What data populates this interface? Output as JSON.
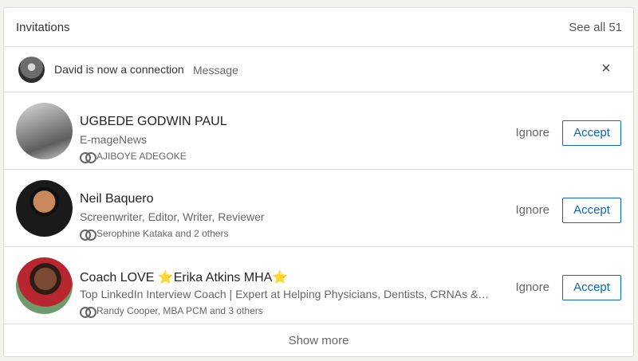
{
  "header": {
    "title": "Invitations",
    "see_all": "See all 51"
  },
  "notice": {
    "text": "David is now a connection",
    "message_label": "Message",
    "close_glyph": "×"
  },
  "invitations": [
    {
      "name": "UGBEDE GODWIN PAUL",
      "headline": "E-mageNews",
      "mutual": "AJIBOYE ADEGOKE",
      "ignore_label": "Ignore",
      "accept_label": "Accept"
    },
    {
      "name": "Neil Baquero",
      "headline": "Screenwriter, Editor, Writer, Reviewer",
      "mutual": "Serophine Kataka and 2 others",
      "ignore_label": "Ignore",
      "accept_label": "Accept"
    },
    {
      "name": "Coach LOVE ⭐Erika Atkins MHA⭐",
      "headline": "Top LinkedIn Interview Coach | Expert at Helping Physicians, Dentists, CRNAs &…",
      "mutual": "Randy Cooper, MBA PCM and 3 others",
      "ignore_label": "Ignore",
      "accept_label": "Accept"
    }
  ],
  "footer": {
    "show_more": "Show more"
  },
  "colors": {
    "accent": "#0a66c2",
    "text": "#222222",
    "muted": "#666666"
  }
}
